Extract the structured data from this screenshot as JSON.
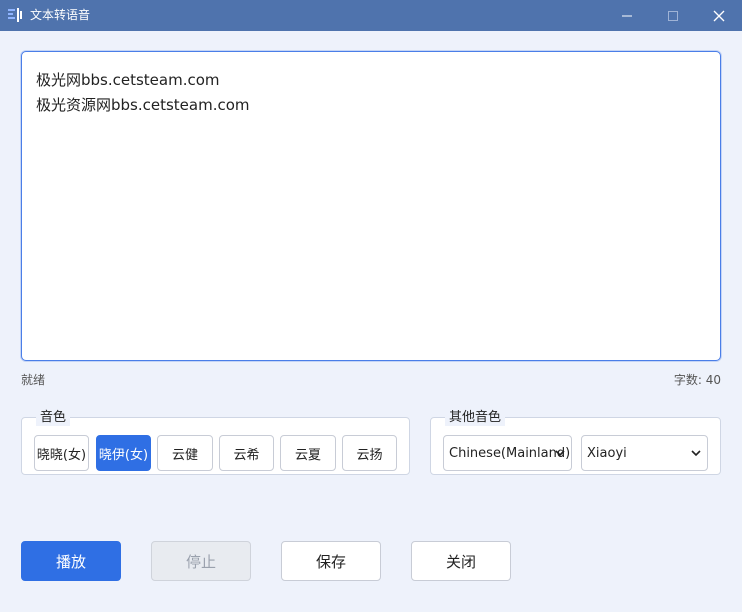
{
  "window": {
    "title": "文本转语音",
    "controls": {
      "minimize": "minimize-icon",
      "maximize": "maximize-icon",
      "close": "close-icon"
    }
  },
  "editor": {
    "lines": [
      "极光网bbs.cetsteam.com",
      "极光资源网bbs.cetsteam.com"
    ]
  },
  "status": {
    "state": "就绪",
    "char_count": "字数: 40"
  },
  "voice_group": {
    "legend": "音色",
    "options": [
      "晓晓(女)",
      "晓伊(女)",
      "云健",
      "云希",
      "云夏",
      "云扬"
    ],
    "selected": "晓伊(女)"
  },
  "other_voice_group": {
    "legend": "其他音色",
    "language_value": "Chinese(Mainland)",
    "voice_value": "Xiaoyi"
  },
  "actions": {
    "play": "播放",
    "stop": "停止",
    "save": "保存",
    "close": "关闭"
  },
  "colors": {
    "titlebar": "#4f73ad",
    "accent": "#2f6fe4",
    "background": "#eef2fb"
  }
}
